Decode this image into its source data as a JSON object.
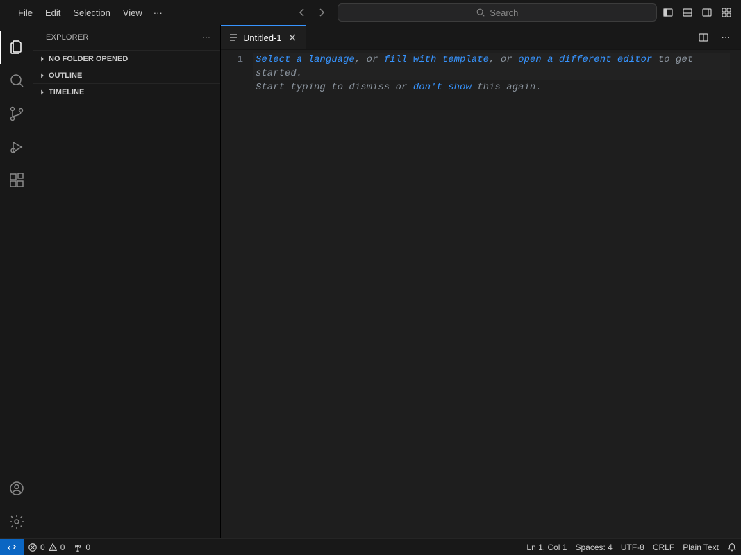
{
  "menu": {
    "file": "File",
    "edit": "Edit",
    "selection": "Selection",
    "view": "View",
    "overflow": "···"
  },
  "search": {
    "placeholder": "Search"
  },
  "sidebar": {
    "title": "EXPLORER",
    "sections": [
      {
        "label": "NO FOLDER OPENED"
      },
      {
        "label": "OUTLINE"
      },
      {
        "label": "TIMELINE"
      }
    ]
  },
  "tab": {
    "title": "Untitled-1"
  },
  "editor": {
    "line_number": "1",
    "hint": {
      "link1": "Select a language",
      "sep1": ", or ",
      "link2": "fill with template",
      "sep2": ", or ",
      "link3": "open a different editor",
      "tail1": " to get started.",
      "line2a": "Start typing to dismiss or ",
      "link4": "don't show",
      "line2b": " this again."
    }
  },
  "status": {
    "errors": "0",
    "warnings": "0",
    "ports": "0",
    "position": "Ln 1, Col 1",
    "indent": "Spaces: 4",
    "encoding": "UTF-8",
    "eol": "CRLF",
    "language": "Plain Text"
  }
}
